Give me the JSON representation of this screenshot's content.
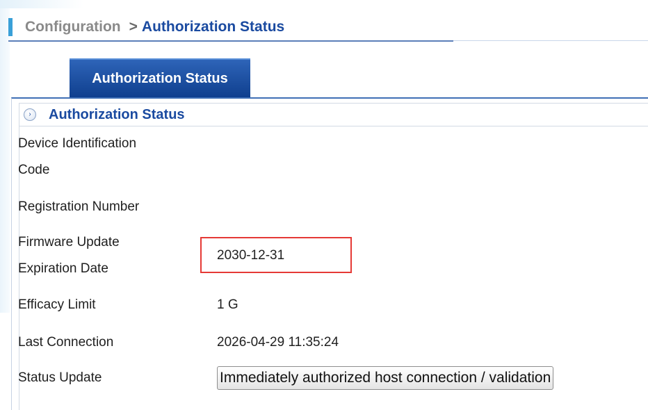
{
  "breadcrumb": {
    "root": "Configuration",
    "separator": ">",
    "current": "Authorization Status"
  },
  "tabs": [
    {
      "label": "Authorization Status",
      "active": true
    }
  ],
  "panel": {
    "title": "Authorization Status",
    "header_icon": "expand-arrow-icon"
  },
  "rows": [
    {
      "label_line1": "Device Identification",
      "label_line2": "Code",
      "value": ""
    },
    {
      "label": "Registration Number",
      "value": ""
    },
    {
      "label_line1": "Firmware Update",
      "label_line2": "Expiration Date",
      "value": "2030-12-31"
    },
    {
      "label": "Efficacy Limit",
      "value": "1 G"
    },
    {
      "label": "Last Connection",
      "value": "2026-04-29 11:35:24"
    },
    {
      "label": "Status Update",
      "button_label": "Immediately authorized host connection / validation"
    }
  ],
  "colors": {
    "accent": "#1a4aa0",
    "tab_bg": "#1f52a6",
    "highlight": "#e53935",
    "crumb_marker": "#3aa0d8"
  }
}
